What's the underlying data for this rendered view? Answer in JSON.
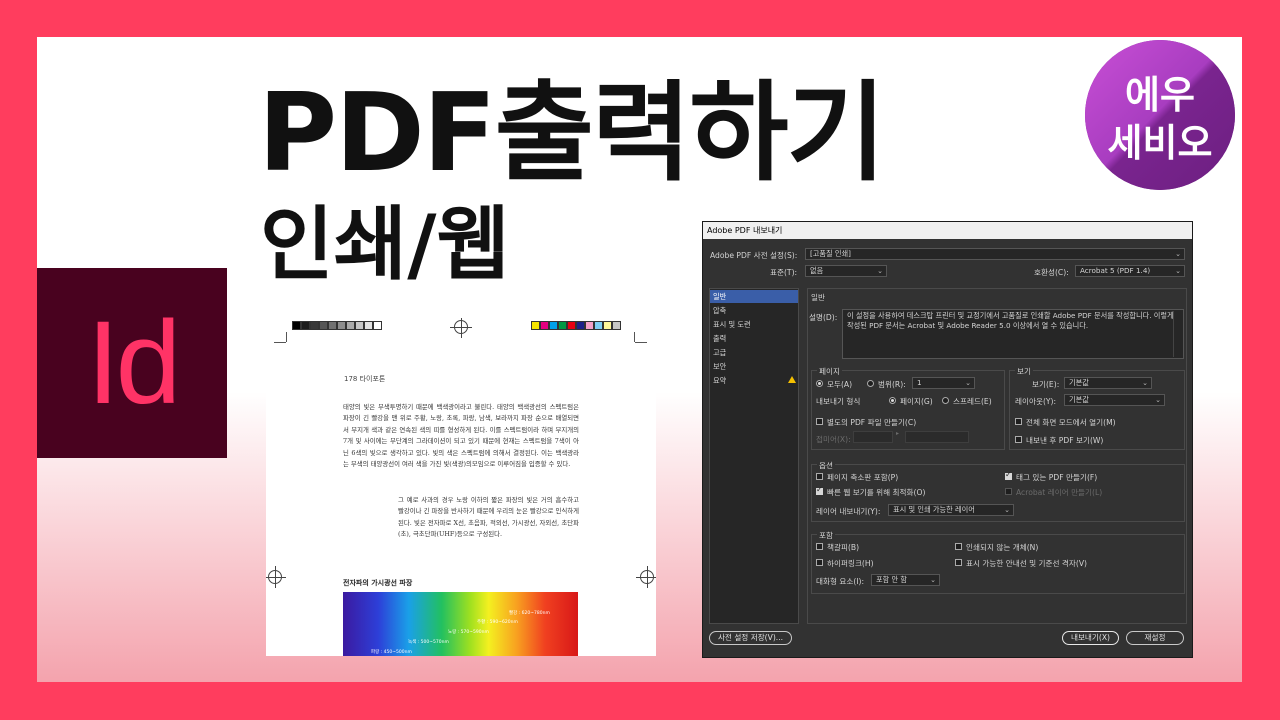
{
  "hero": {
    "title": "PDF출력하기",
    "subtitle": "인쇄/웹",
    "app_logo": "Id",
    "brand_line1": "에우",
    "brand_line2": "세비오"
  },
  "colors": {
    "frame": "#ff3d5e",
    "indesign_bg": "#49021f",
    "indesign_fg": "#ff3366",
    "brand_purple": "#7b2592",
    "dialog_bg": "#323232",
    "nav_active": "#3a5ea8"
  },
  "document": {
    "page_number": "178 타이포톤",
    "paragraph1": "태양의 빛은 무색투명하기 때문에 백색광이라고 불린다. 태양의 백색광선의 스펙트럼은 파장이 긴 빨강을 맨 위로 주황, 노랑, 초록, 파랑, 남색, 보라까지 파장 순으로 배열되면서 무지개 색과 같은 연속된 색의 띠를 형성하게 된다. 이를 스펙트럼이라 하며 무지개의 7개 및 사이에는 무단계의 그라데이션이 되고 있기 때문에 현재는 스펙트럼을 7색이 아닌 6색의 빛으로 생각하고 있다. 빛의 색은 스펙트럼에 의해서 결정된다. 이는 백색광라는 무색의 태양광선이 여러 색을 가진 빛(색광)의모임으로 이루어짐을 입증할 수 있다.",
    "paragraph2": "그 예로 사과의 경우 노랑 이하의 짧은 파장의 빛은 거의 흡수하고 빨강이나 긴 파장을 반사하기 때문에 우리의 눈은 빨강으로 인식하게 된다. 빛은 전자파로 X선, 초음파, 적외선, 가시광선, 자외선, 초단파(초), 극초단파(UHF)등으로 구성된다.",
    "spectrum_title": "전자파의 가시광선 파장",
    "spectrum_labels": [
      "빨강 : 620~780nm",
      "주황 : 590~620nm",
      "노랑 : 570~590nm",
      "녹색 : 500~570nm",
      "파랑 : 450~500nm"
    ],
    "colorbar_gray": [
      "#000000",
      "#1c1c1c",
      "#383838",
      "#555555",
      "#717171",
      "#8d8d8d",
      "#aaaaaa",
      "#c6c6c6",
      "#e2e2e2",
      "#ffffff"
    ],
    "colorbar_color": [
      "#f5e400",
      "#e4007f",
      "#00a0e9",
      "#009944",
      "#e60012",
      "#1d2088",
      "#f5a0c8",
      "#7fcef4",
      "#fff799",
      "#c7c7c7"
    ]
  },
  "dialog": {
    "title": "Adobe PDF 내보내기",
    "preset_label": "Adobe PDF 사전 설정(S):",
    "preset_value": "[고품질 인쇄]",
    "standard_label": "표준(T):",
    "standard_value": "없음",
    "compat_label": "호환성(C):",
    "compat_value": "Acrobat 5 (PDF 1.4)",
    "nav": [
      "일반",
      "압축",
      "표시 및 도련",
      "출력",
      "고급",
      "보안",
      "요약"
    ],
    "section_title": "일반",
    "desc_label": "설명(D):",
    "description": "이 설정을 사용하여 데스크탑 프린터 및 교정기에서 고품질로 인쇄할 Adobe PDF 문서를 작성합니다. 이렇게 작성된 PDF 문서는 Acrobat 및 Adobe Reader 5.0 이상에서 열 수 있습니다.",
    "pages": {
      "title": "페이지",
      "all": "모두(A)",
      "range": "범위(R):",
      "range_value": "1",
      "export_as": "내보내기 형식",
      "pages_opt": "페이지(G)",
      "spreads_opt": "스프레드(E)",
      "separate_pdf": "별도의 PDF 파일 만들기(C)",
      "suffix": "접미어(X):"
    },
    "view": {
      "title": "보기",
      "view_label": "보기(E):",
      "view_value": "기본값",
      "layout_label": "레이아웃(Y):",
      "layout_value": "기본값",
      "fullscreen": "전체 화면 모드에서 열기(M)",
      "view_after": "내보낸 후 PDF 보기(W)"
    },
    "options": {
      "title": "옵션",
      "embed_thumbs": "페이지 축소판 포함(P)",
      "fast_web": "빠른 웹 보기를 위해 최적화(O)",
      "tagged": "태그 있는 PDF 만들기(F)",
      "acrobat_layers": "Acrobat 레이어 만들기(L)",
      "export_layers_label": "레이어 내보내기(Y):",
      "export_layers_value": "표시 및 인쇄 가능한 레이어"
    },
    "include": {
      "title": "포함",
      "bookmarks": "책갈피(B)",
      "hyperlinks": "하이퍼링크(H)",
      "nonprinting": "인쇄되지 않는 개체(N)",
      "guides": "표시 가능한 안내선 및 기준선 격자(V)",
      "interactive_label": "대화형 요소(I):",
      "interactive_value": "포함 안 함"
    },
    "save_preset": "사전 설정 저장(V)...",
    "export": "내보내기(X)",
    "reset": "재설정"
  }
}
